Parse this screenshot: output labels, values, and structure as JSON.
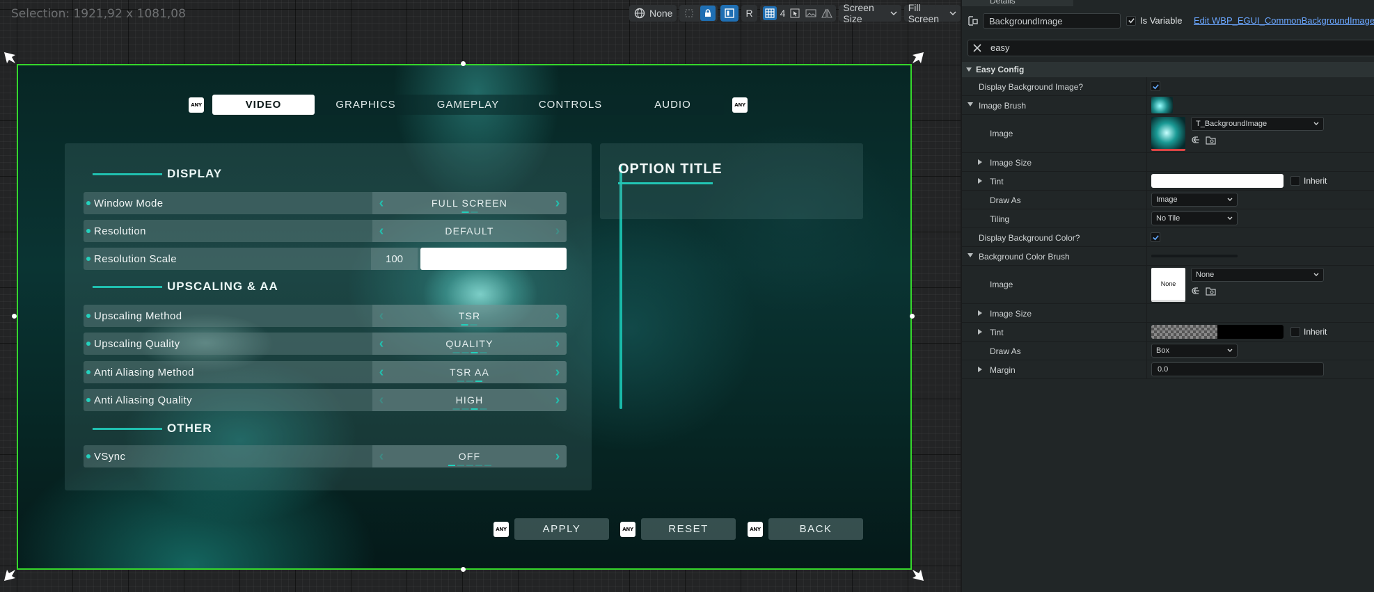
{
  "canvas": {
    "selection_text": "Selection: 1921,92 x 1081,08",
    "toolbar": {
      "locale_label": "None",
      "respect_locks_label": "R",
      "grid_size": "4",
      "screen_size_label": "Screen Size",
      "fill_label": "Fill Screen"
    }
  },
  "menu": {
    "any_key_label": "ANY",
    "tabs": [
      "VIDEO",
      "GRAPHICS",
      "GAMEPLAY",
      "CONTROLS",
      "AUDIO"
    ],
    "active_tab": "VIDEO",
    "sections": {
      "display": "DISPLAY",
      "upscaling": "UPSCALING & AA",
      "other": "OTHER"
    },
    "rows": {
      "window_mode": {
        "label": "Window Mode",
        "value": "FULL SCREEN"
      },
      "resolution": {
        "label": "Resolution",
        "value": "DEFAULT"
      },
      "resolution_scale": {
        "label": "Resolution Scale",
        "value": "100"
      },
      "upscaling_method": {
        "label": "Upscaling Method",
        "value": "TSR"
      },
      "upscaling_quality": {
        "label": "Upscaling Quality",
        "value": "QUALITY"
      },
      "aa_method": {
        "label": "Anti Aliasing Method",
        "value": "TSR AA"
      },
      "aa_quality": {
        "label": "Anti Aliasing Quality",
        "value": "HIGH"
      },
      "vsync": {
        "label": "VSync",
        "value": "OFF"
      }
    },
    "option_title": "OPTION TITLE",
    "buttons": {
      "apply": "APPLY",
      "reset": "RESET",
      "back": "BACK"
    }
  },
  "details": {
    "tab_label": "Details",
    "widget_name": "BackgroundImage",
    "is_variable_label": "Is Variable",
    "edit_link": "Edit WBP_EGUI_CommonBackgroundImage",
    "search_value": "easy",
    "category": "Easy Config",
    "props": {
      "display_bg_image": "Display Background Image?",
      "image_brush": "Image Brush",
      "image": "Image",
      "image_value": "T_BackgroundImage",
      "image_size": "Image Size",
      "tint": "Tint",
      "inherit": "Inherit",
      "draw_as": "Draw As",
      "draw_as_value": "Image",
      "tiling": "Tiling",
      "tiling_value": "No Tile",
      "display_bg_color": "Display Background Color?",
      "bg_color_brush": "Background Color Brush",
      "image2": "Image",
      "none_thumb": "None",
      "image2_value": "None",
      "image_size2": "Image Size",
      "tint2": "Tint",
      "inherit2": "Inherit",
      "draw_as2": "Draw As",
      "draw_as2_value": "Box",
      "margin": "Margin",
      "margin_value": "0.0"
    }
  },
  "colors": {
    "selection_border": "#36d72b",
    "accent": "#22c6b5",
    "link": "#6aa6ff"
  }
}
